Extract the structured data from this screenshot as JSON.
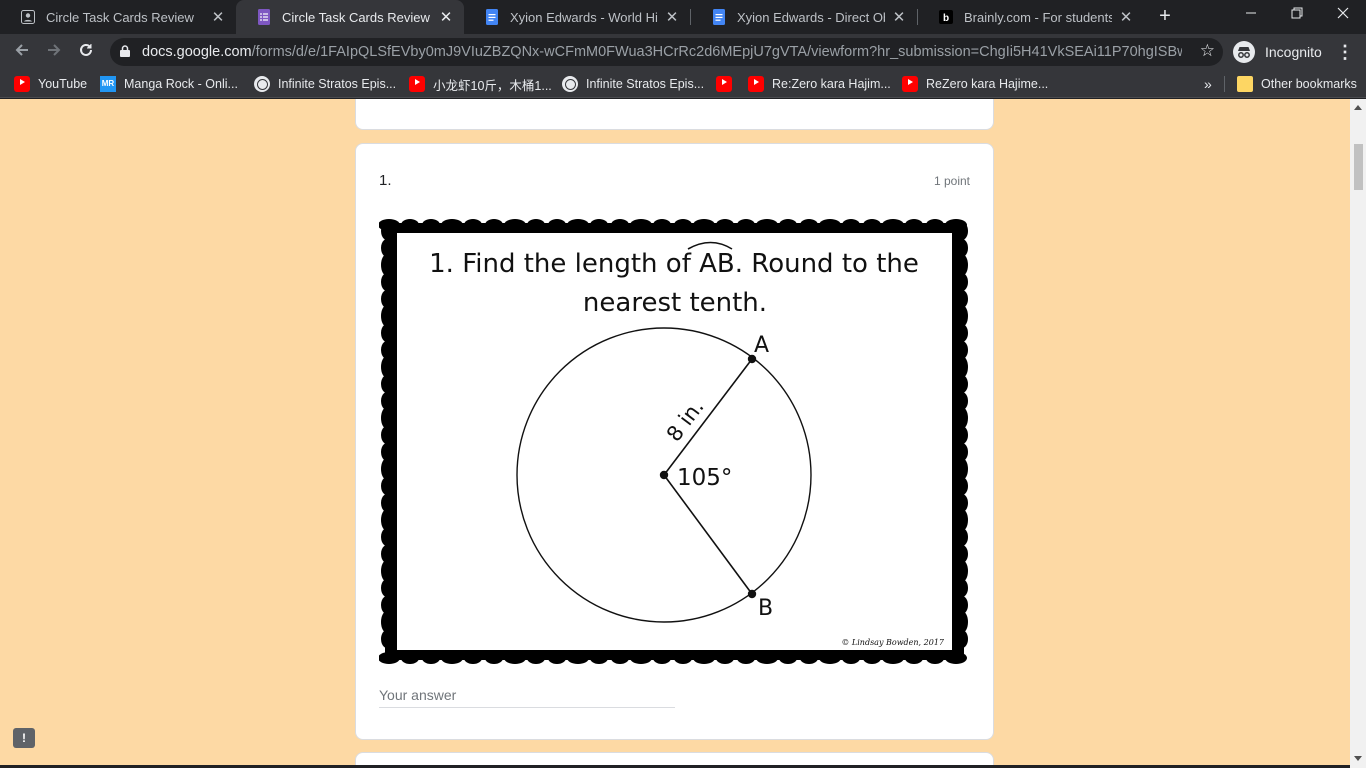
{
  "browser": {
    "tabs": [
      {
        "title": "Circle Task Cards Review",
        "icon": "google-account-icon"
      },
      {
        "title": "Circle Task Cards Review",
        "icon": "google-forms-icon",
        "active": true
      },
      {
        "title": "Xyion Edwards - World History",
        "icon": "google-docs-icon"
      },
      {
        "title": "Xyion Edwards - Direct Object",
        "icon": "google-docs-icon"
      },
      {
        "title": "Brainly.com - For students. By",
        "icon": "brainly-icon"
      }
    ],
    "new_tab": "+",
    "address": {
      "host": "docs.google.com",
      "path": "/forms/d/e/1FAIpQLSfEVby0mJ9VIuZBZQNx-wCFmM0FWua3HCrRc2d6MEpjU7gVTA/viewform?hr_submission=ChgIi5H41VkSEAi11P70hgISBwjy_ry4lg..."
    },
    "profile_label": "Incognito",
    "bookmarks": [
      {
        "label": "YouTube",
        "icon": "youtube-icon"
      },
      {
        "label": "Manga Rock - Onli...",
        "icon": "mangarock-icon",
        "icon_text": "MR"
      },
      {
        "label": "Infinite Stratos Epis...",
        "icon": "globe-icon"
      },
      {
        "label": "小龙虾10斤，木桶1...",
        "icon": "youtube-icon"
      },
      {
        "label": "Infinite Stratos Epis...",
        "icon": "globe-icon"
      },
      {
        "label": "",
        "icon": "youtube-icon"
      },
      {
        "label": "Re:Zero kara Hajim...",
        "icon": "youtube-icon"
      },
      {
        "label": "ReZero kara Hajime...",
        "icon": "youtube-icon"
      }
    ],
    "more_bookmarks": "»",
    "other_bookmarks": "Other bookmarks"
  },
  "form": {
    "background_color": "#fdd9a4",
    "question": {
      "number": "1.",
      "points": "1 point",
      "image": {
        "prompt_prefix": "1. Find the length of",
        "arc_label": "AB",
        "prompt_suffix": ". Round to the",
        "prompt_line2": "nearest tenth.",
        "radius_label": "8 in.",
        "angle_label": "105°",
        "point_a": "A",
        "point_b": "B",
        "credit": "© Lindsay Bowden, 2017"
      },
      "answer_placeholder": "Your answer",
      "answer_value": ""
    }
  }
}
